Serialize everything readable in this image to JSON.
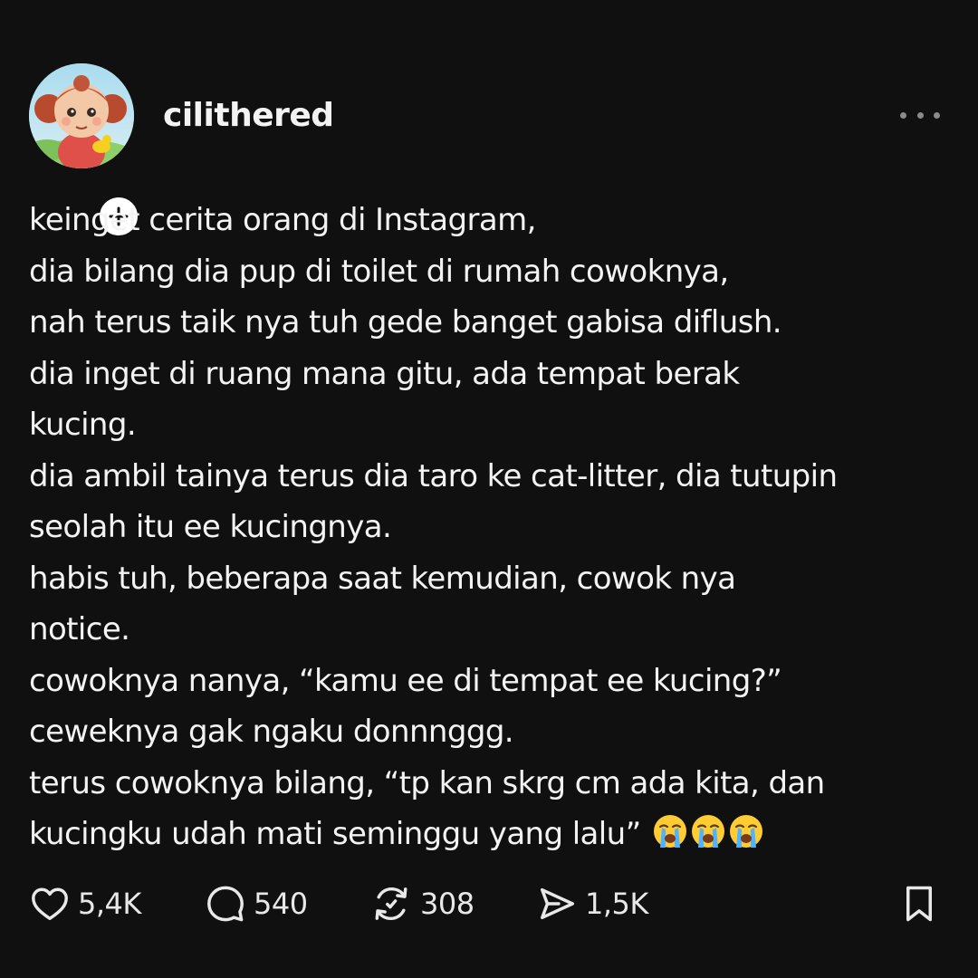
{
  "post": {
    "author": {
      "username": "cilithered",
      "avatar": "cartoon-girl-avatar",
      "follow_icon": "plus-icon"
    },
    "more_icon": "more-horizontal-icon",
    "text_lines": [
      "keinget cerita orang di Instagram,",
      "dia bilang dia pup di toilet di rumah cowoknya,",
      "nah terus taik nya tuh gede banget gabisa diflush.",
      "dia inget di ruang mana gitu, ada tempat berak",
      "kucing.",
      "dia ambil tainya terus dia taro ke cat-litter, dia tutupin",
      "seolah itu ee kucingnya.",
      "habis tuh, beberapa saat kemudian, cowok nya",
      "notice.",
      "cowoknya nanya, “kamu ee di tempat ee kucing?”",
      "ceweknya gak ngaku donnnggg.",
      "terus cowoknya bilang, “tp kan skrg cm ada kita, dan",
      "kucingku udah mati seminggu yang lalu” "
    ],
    "emoji": [
      "loudly-crying-face",
      "loudly-crying-face",
      "loudly-crying-face"
    ],
    "actions": {
      "likes": "5,4K",
      "replies": "540",
      "reposts": "308",
      "shares": "1,5K"
    },
    "icons": {
      "like": "heart-icon",
      "reply": "speech-bubble-icon",
      "repost": "repost-icon",
      "share": "send-icon",
      "save": "bookmark-icon"
    }
  },
  "colors": {
    "background": "#101010",
    "text": "#f3f3f3",
    "muted": "#8a8a8a"
  }
}
